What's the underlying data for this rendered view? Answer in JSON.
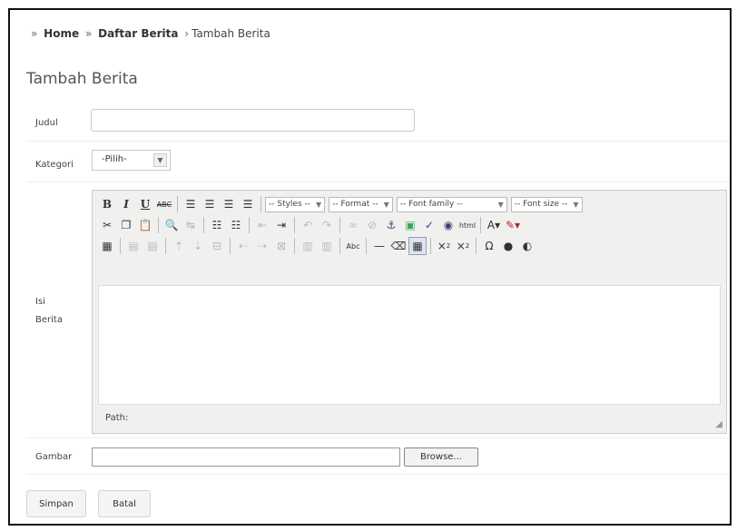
{
  "breadcrumb": {
    "home": "Home",
    "list": "Daftar Berita",
    "current": "Tambah Berita",
    "sep": "»",
    "sep_last": "›"
  },
  "page_title": "Tambah Berita",
  "form": {
    "judul_label": "Judul",
    "judul_value": "",
    "kategori_label": "Kategori",
    "kategori_selected": "-Pilih-",
    "isi_label": "Isi Berita",
    "gambar_label": "Gambar",
    "gambar_value": "",
    "browse_label": "Browse...",
    "simpan_label": "Simpan",
    "batal_label": "Batal"
  },
  "editor": {
    "styles": "-- Styles --",
    "format": "-- Format --",
    "font_family": "-- Font family --",
    "font_size": "-- Font size --",
    "path_label": "Path:",
    "content": ""
  }
}
